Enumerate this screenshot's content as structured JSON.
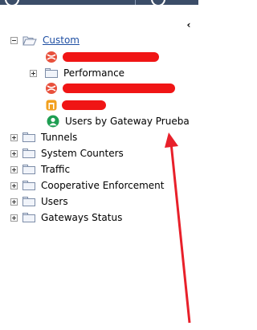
{
  "window": {
    "collapse_glyph": "‹"
  },
  "tree": {
    "root": {
      "label": "Custom",
      "icon": "open-folder-icon",
      "expanded": true,
      "children": [
        {
          "type": "redacted",
          "icon": "red-ball-icon"
        },
        {
          "type": "folder",
          "label": "Performance",
          "icon": "folder-icon",
          "expanded": false
        },
        {
          "type": "redacted",
          "icon": "red-ball-icon"
        },
        {
          "type": "redacted",
          "icon": "orange-gauge-icon"
        },
        {
          "type": "view",
          "label": "Users by Gateway Prueba",
          "icon": "user-icon"
        }
      ]
    },
    "folders": [
      {
        "label": "Tunnels"
      },
      {
        "label": "System Counters"
      },
      {
        "label": "Traffic"
      },
      {
        "label": "Cooperative Enforcement"
      },
      {
        "label": "Users"
      },
      {
        "label": "Gateways Status"
      }
    ]
  },
  "annotation": {
    "arrow_color": "#e8202a",
    "redaction_color": "#f01515"
  }
}
